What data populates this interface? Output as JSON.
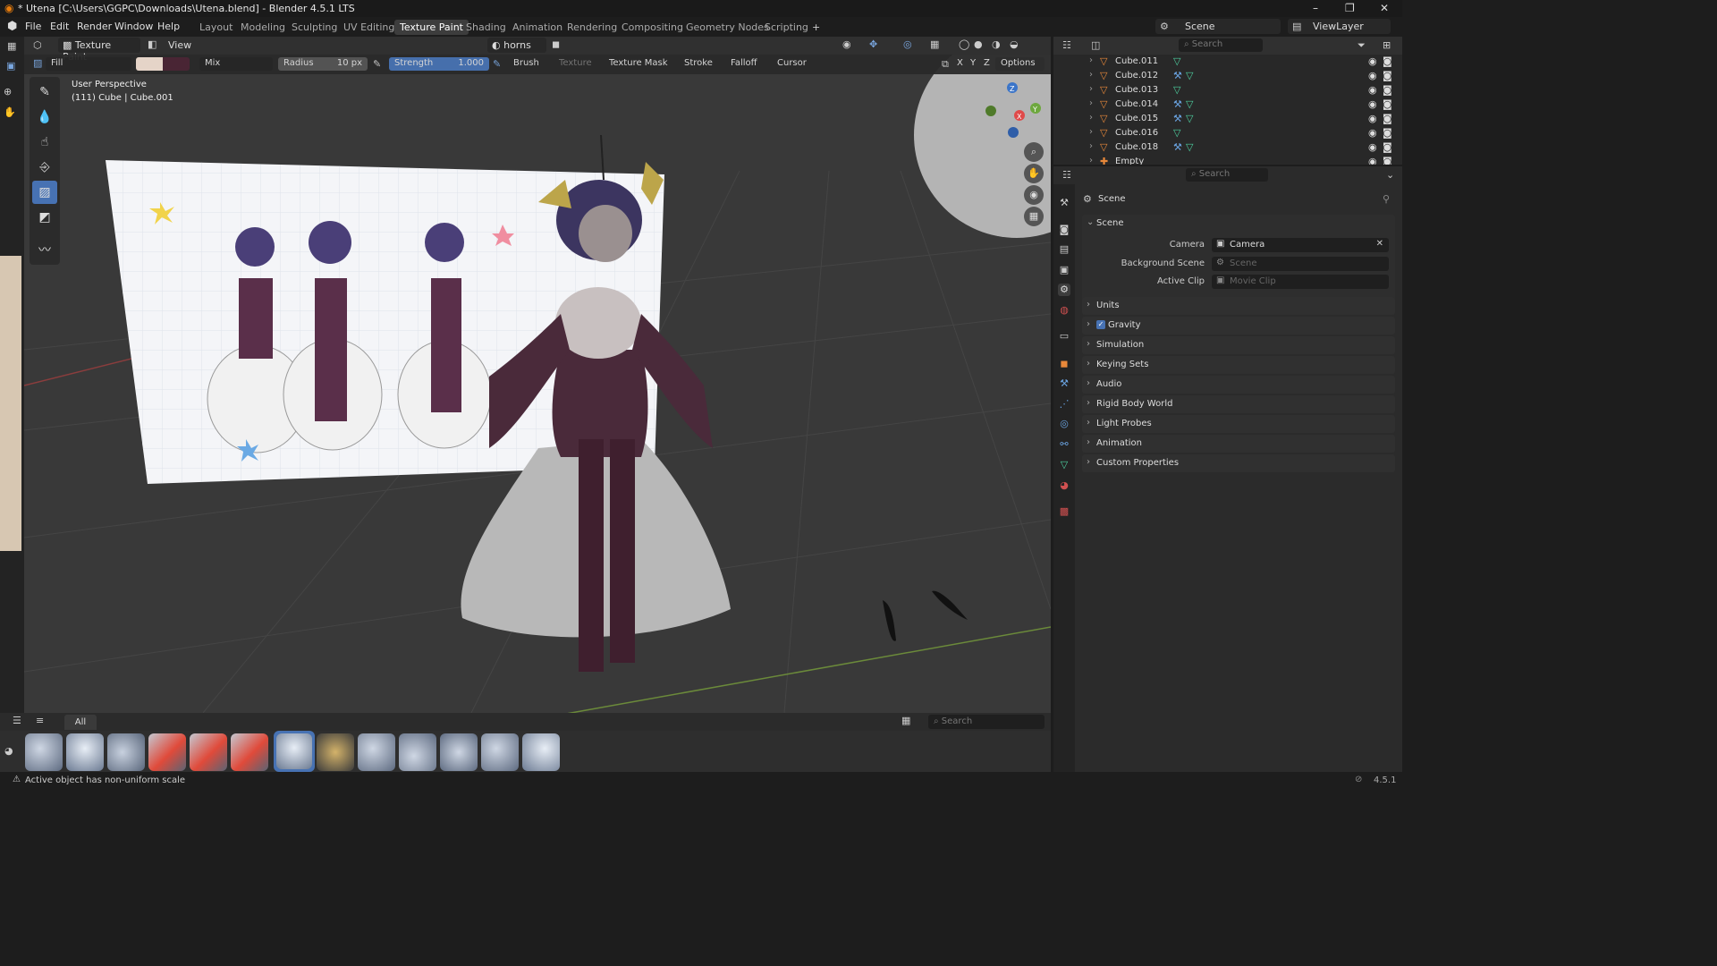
{
  "window": {
    "title": "* Utena [C:\\Users\\GGPC\\Downloads\\Utena.blend] - Blender 4.5.1 LTS",
    "controls": [
      "–",
      "❐",
      "✕"
    ]
  },
  "menu": [
    "File",
    "Edit",
    "Render",
    "Window",
    "Help"
  ],
  "workspaces": [
    "Layout",
    "Modeling",
    "Sculpting",
    "UV Editing",
    "Texture Paint",
    "Shading",
    "Animation",
    "Rendering",
    "Compositing",
    "Geometry Nodes",
    "Scripting",
    "+"
  ],
  "active_workspace": "Texture Paint",
  "scene_selector": {
    "label": "Scene",
    "view_layer": "ViewLayer"
  },
  "viewport_header": {
    "mode": "Texture Paint",
    "view": "View",
    "texture_slot": "horns"
  },
  "tool_settings": {
    "fill": "Fill",
    "blend": "Mix",
    "radius_label": "Radius",
    "radius_value": "10 px",
    "strength_label": "Strength",
    "strength_value": "1.000",
    "brush": "Brush",
    "texture": "Texture",
    "texture_mask": "Texture Mask",
    "stroke": "Stroke",
    "falloff": "Falloff",
    "cursor": "Cursor",
    "axes": [
      "X",
      "Y",
      "Z"
    ],
    "options": "Options",
    "color_primary": "#efddd0",
    "color_secondary": "#4a2434"
  },
  "viewport": {
    "perspective": "User Perspective",
    "object_info": "(111) Cube | Cube.001",
    "gizmo": {
      "z": "Z",
      "y": "Y",
      "x": "X"
    }
  },
  "asset_shelf": {
    "tab_all": "All",
    "search_placeholder": "Search"
  },
  "status": {
    "message": "Active object has non-uniform scale",
    "version": "4.5.1"
  },
  "outliner": {
    "search_placeholder": "Search",
    "items": [
      "Cube.011",
      "Cube.012",
      "Cube.013",
      "Cube.014",
      "Cube.015",
      "Cube.016",
      "Cube.018",
      "Empty"
    ]
  },
  "properties": {
    "search_placeholder": "Search",
    "context": "Scene",
    "section": "Scene",
    "camera_label": "Camera",
    "camera_value": "Camera",
    "bg_scene_label": "Background Scene",
    "bg_scene_placeholder": "Scene",
    "active_clip_label": "Active Clip",
    "active_clip_placeholder": "Movie Clip",
    "panels": [
      "Units",
      "Gravity",
      "Simulation",
      "Keying Sets",
      "Audio",
      "Rigid Body World",
      "Light Probes",
      "Animation",
      "Custom Properties"
    ]
  }
}
